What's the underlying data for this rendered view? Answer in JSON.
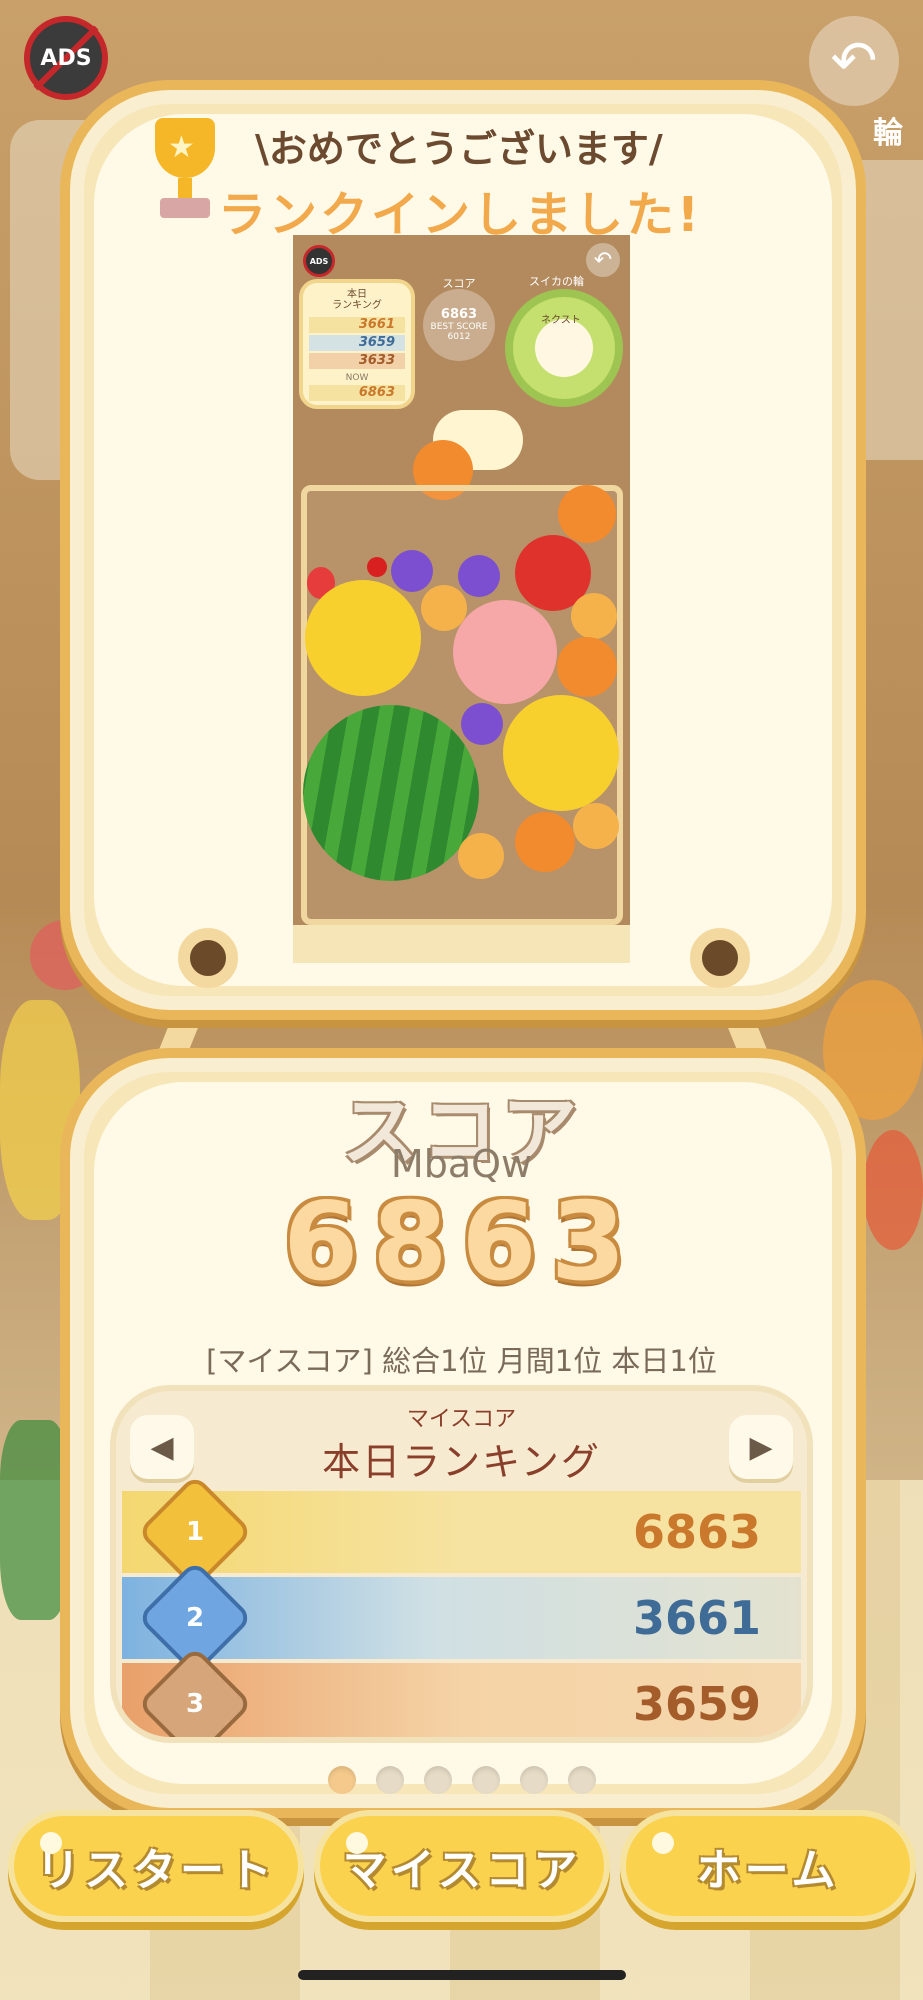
{
  "top_bar": {
    "ads_label": "ADS",
    "ring_label": "輪"
  },
  "banner": {
    "line1": "\\おめでとうございます/",
    "line2": "ランクインしました!"
  },
  "thumbnail": {
    "ads_label": "ADS",
    "ranking_title": "本日\nランキング",
    "rows": [
      {
        "value": "3661",
        "color": "#c9782c"
      },
      {
        "value": "3659",
        "color": "#3f6c96"
      },
      {
        "value": "3633",
        "color": "#a35c2a"
      },
      {
        "value": "6863",
        "color": "#c9782c"
      }
    ],
    "now_label": "NOW",
    "score_label": "スコア",
    "score_value": "6863",
    "best_label": "BEST SCORE",
    "best_value": "6012",
    "ring_label": "スイカの輪",
    "next_label": "ネクスト"
  },
  "result": {
    "title": "スコア",
    "player_name": "MbaQw",
    "score": "6863",
    "my_rank_line": "[マイスコア]  総合1位  月間1位  本日1位"
  },
  "ranking": {
    "subtitle": "マイスコア",
    "title": "本日ランキング",
    "rows": [
      {
        "rank": "1",
        "score": "6863"
      },
      {
        "rank": "2",
        "score": "3661"
      },
      {
        "rank": "3",
        "score": "3659"
      }
    ]
  },
  "pager": {
    "count": 6,
    "active": 0
  },
  "buttons": {
    "restart": "リスタート",
    "my_score": "マイスコア",
    "home": "ホーム"
  },
  "colors": {
    "accent": "#fbd24e",
    "frame": "#e9b75a",
    "rank1": "#c9782c",
    "rank2": "#3f6c96",
    "rank3": "#a35c2a"
  },
  "icons": [
    "no-ads-icon",
    "undo-icon",
    "trophy-icon",
    "left-arrow-icon",
    "right-arrow-icon",
    "gold-medal-icon",
    "silver-medal-icon",
    "bronze-medal-icon"
  ]
}
